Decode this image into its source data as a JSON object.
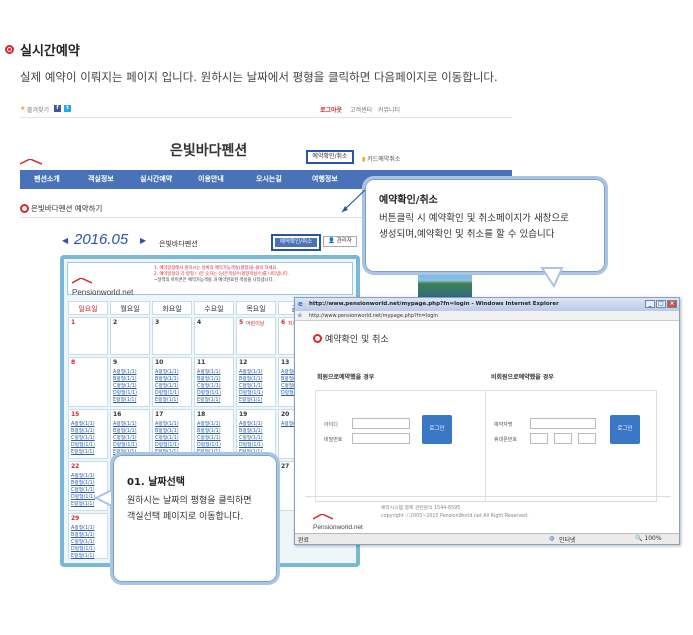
{
  "section": {
    "title": "실시간예약",
    "description": "실제 예약이 이뤄지는 페이지 입니다. 원하시는 날짜에서 평형을 클릭하면 다음페이지로 이동합니다."
  },
  "site": {
    "topbar": {
      "favorite": "즐겨찾기",
      "logout": "로그아웃",
      "support": "고객센터",
      "community": "커뮤니티"
    },
    "logo": "Pensionworld.net",
    "title": "은빛바다펜션",
    "top_menu": {
      "reservation_check": "예약확인/취소",
      "card_refund": "카드예약취소"
    },
    "nav": [
      "펜션소개",
      "객실정보",
      "실시간예약",
      "이용안내",
      "오시는길",
      "여행정보"
    ],
    "page_heading": "은빛바다펜션 예약하기",
    "calendar": {
      "month_label": "2016.05",
      "pension_name": "은빛바다펜션",
      "check_button": "예약확인/취소",
      "admin_button": "관리자",
      "notice_1": "1. 예약일정에서 원하시는 날짜의 예약가능객실(평형)을 클릭 하세요.",
      "notice_2": "2. 예약일정의 각 평형 ( )안 숫자는 (남은객실수/평형객실수)를 나타냅니다.",
      "legend": "~달력의 아이콘은 예약가능객실 과 예약완료된 객실을 나타냅니다.",
      "days": [
        "일요일",
        "월요일",
        "화요일",
        "수요일",
        "목요일",
        "금요"
      ],
      "week1": [
        {
          "date": "1",
          "label": ""
        },
        {
          "date": "2",
          "label": ""
        },
        {
          "date": "3",
          "label": ""
        },
        {
          "date": "4",
          "label": ""
        },
        {
          "date": "5",
          "label": "어린이날"
        },
        {
          "date": "6",
          "label": "지정"
        }
      ],
      "week2_dates": [
        "8",
        "9",
        "10",
        "11",
        "12",
        "13"
      ],
      "week3_dates": [
        "15",
        "16",
        "17",
        "18",
        "19",
        "20"
      ],
      "week4_dates": [
        "22",
        "23",
        "24",
        "25",
        "26",
        "27"
      ],
      "week5_dates": [
        "29",
        "30",
        "31"
      ],
      "room_links": [
        "A평형(1/1)",
        "B평형(1/1)",
        "C평형(1/1)",
        "D평형(1/1)",
        "E평형(1/1)"
      ]
    }
  },
  "popup": {
    "title_bar": "http://www.pensionworld.net/mypage.php?fn=login - Windows Internet Explorer",
    "address": "http://www.pensionworld.net/mypage.php?fn=login",
    "heading": "예약확인 및 취소",
    "member": {
      "heading": "회원으로예약했을 경우",
      "id_label": "아이디",
      "pw_label": "비밀번호",
      "button": "로그인"
    },
    "guest": {
      "heading": "비회원으로예약했을 경우",
      "name_label": "예약자명",
      "phone_label": "휴대폰번호",
      "button": "로그인"
    },
    "footer_logo": "Pensionworld.net",
    "footer_line1": "예약시스템 결제 관련문의 1544-6595",
    "footer_line2": "copyright ⓒ2005~2015 PensionWorld.net All Right Reserved.",
    "status_left": "완료",
    "status_zone": "인터넷",
    "status_zoom": "100%"
  },
  "callout_reservation": {
    "title": "예약확인/취소",
    "line1": "버튼클릭 시 예약확인 및 취소페이지가 새창으로",
    "line2": "생성되며,예약확인 및 취소를 할 수 있습니다"
  },
  "callout_date": {
    "title": "01. 날짜선택",
    "line1": "원하시는 날짜의 평형을 클릭하면",
    "line2": "객실선택 페이지로 이동합니다."
  },
  "colors": {
    "accent_red": "#d9262b",
    "nav_blue": "#4a72b8",
    "calendar_blue": "#7ab8d6",
    "highlight_blue": "#2a54a5"
  }
}
